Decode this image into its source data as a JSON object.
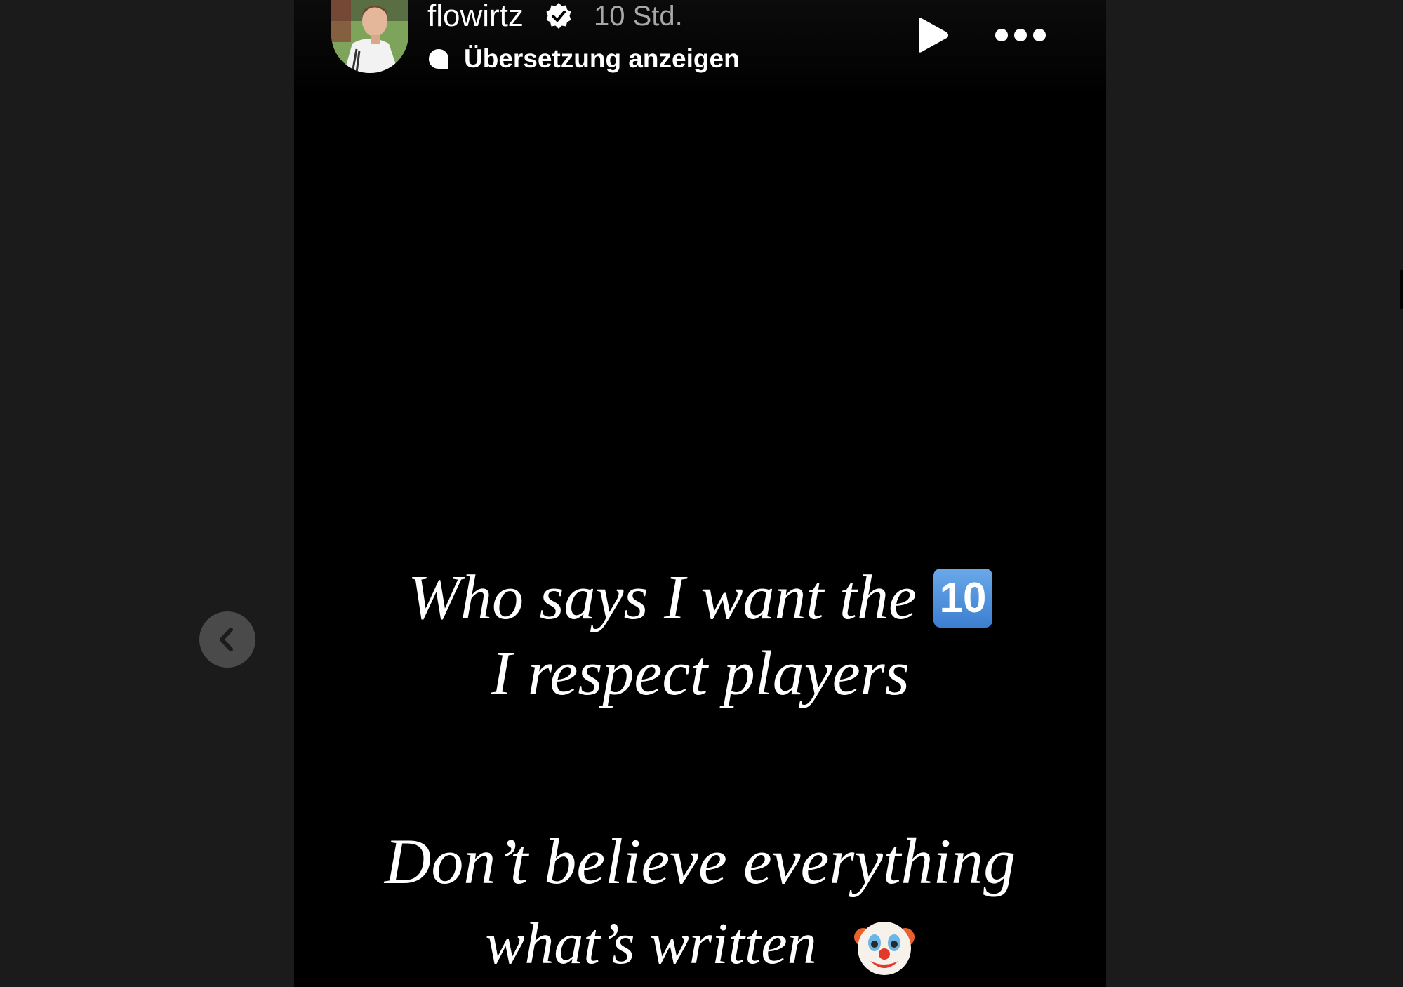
{
  "story": {
    "username": "flowirtz",
    "verified_icon": "verified-badge-icon",
    "time": "10 Std.",
    "translate_label": "Übersetzung anzeigen",
    "play_icon": "play-icon",
    "more_icon": "more-options-icon",
    "lines": {
      "line1": "Who says I want the",
      "line1_emoji": "🔟",
      "line1_emoji_text": "10",
      "line2": "I respect players",
      "line3": "Don’t believe everything",
      "line4": "what’s written",
      "line4_emoji": "🤡"
    }
  },
  "navigation": {
    "prev_icon": "chevron-left-icon"
  },
  "colors": {
    "page_background": "#1b1b1b",
    "story_background": "#000000",
    "text": "#ffffff",
    "time_text": "#a8a8a8",
    "nav_button": "#4a4a4a"
  }
}
